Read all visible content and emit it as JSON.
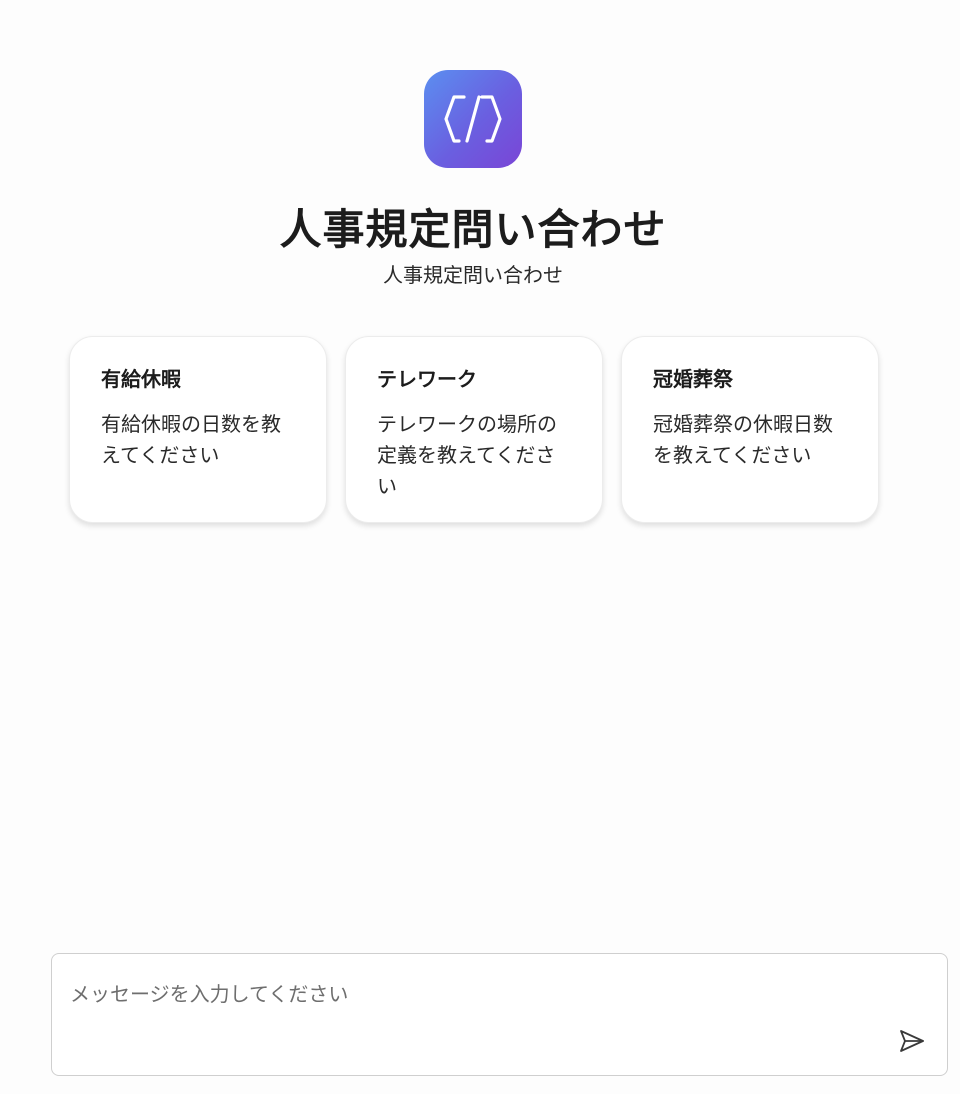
{
  "header": {
    "logo_icon": "code-brackets-icon",
    "logo_gradient": [
      "#5b8ff0",
      "#7a45d6"
    ],
    "title": "人事規定問い合わせ",
    "subtitle": "人事規定問い合わせ"
  },
  "suggestions": [
    {
      "title": "有給休暇",
      "text": "有給休暇の日数を教えてください"
    },
    {
      "title": "テレワーク",
      "text": "テレワークの場所の定義を教えてください"
    },
    {
      "title": "冠婚葬祭",
      "text": "冠婚葬祭の休暇日数を教えてください"
    }
  ],
  "composer": {
    "placeholder": "メッセージを入力してください",
    "value": "",
    "send_icon": "send-icon"
  }
}
